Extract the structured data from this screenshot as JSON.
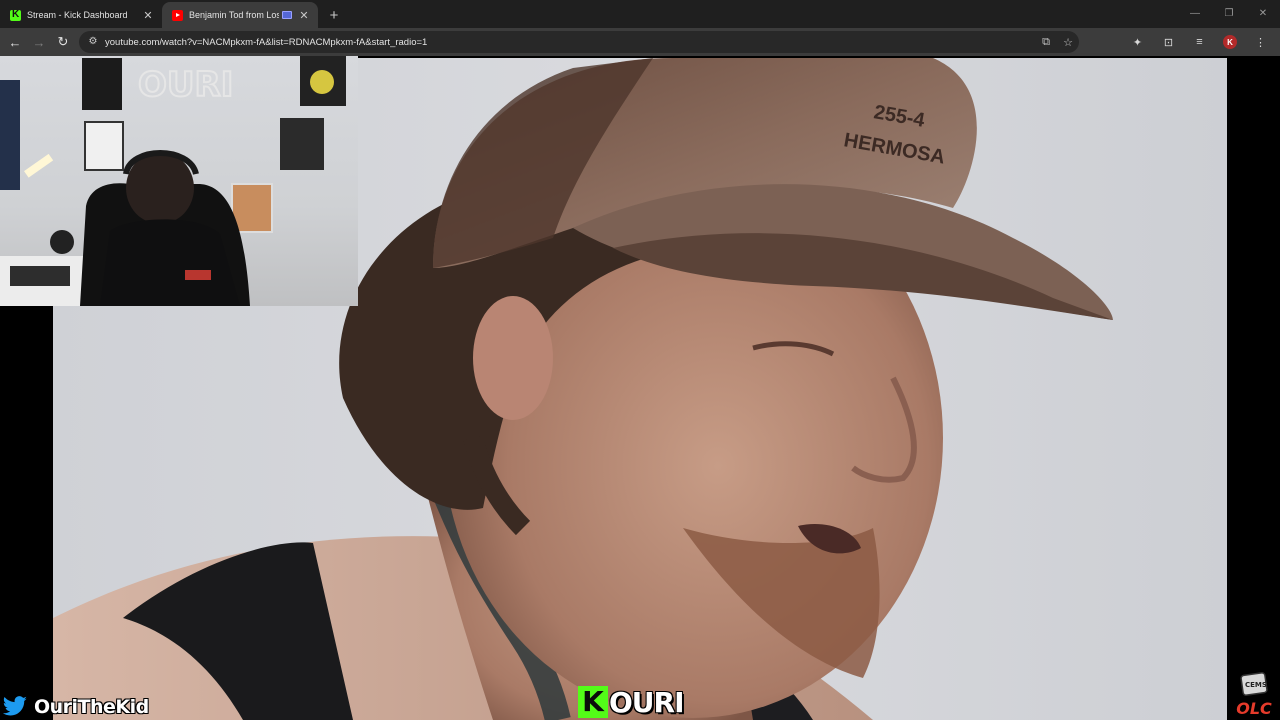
{
  "browser": {
    "tabs": [
      {
        "title": "Stream - Kick Dashboard",
        "favicon": "kick-icon",
        "active": false
      },
      {
        "title": "Benjamin Tod from Lost Do",
        "favicon": "youtube-icon",
        "active": true
      }
    ],
    "new_tab_symbol": "+",
    "address_bar": {
      "url": "youtube.com/watch?v=NACMpkxm-fA&list=RDNACMpkxm-fA&start_radio=1"
    }
  },
  "overlay": {
    "twitter_handle": "OuriTheKid",
    "logo_prefix": "K",
    "logo_text": "OURI",
    "corner_logo_text": "OLC",
    "corner_logo_small": "CEMS"
  },
  "colors": {
    "kick_green": "#53fc18",
    "twitter_blue": "#1d9bf0",
    "olc_red": "#e53b2b",
    "chrome_dark": "#1f1f1f",
    "chrome_toolbar": "#3c3c3c"
  }
}
